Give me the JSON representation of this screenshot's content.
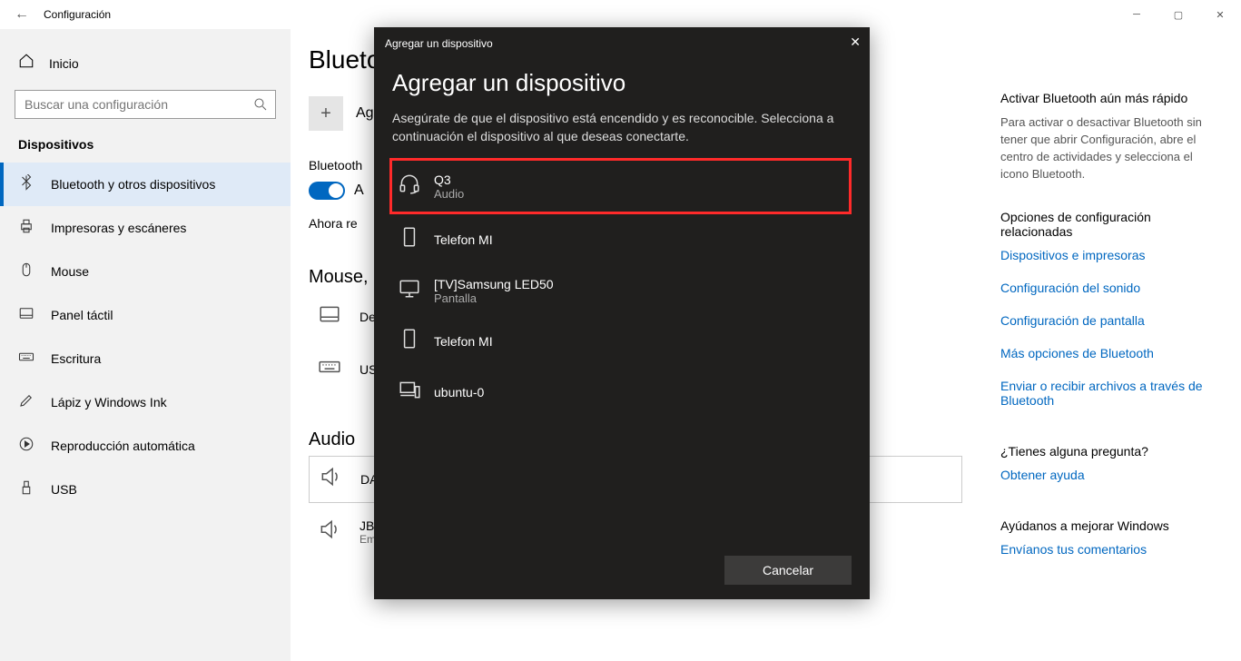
{
  "window": {
    "title": "Configuración"
  },
  "sidebar": {
    "home_label": "Inicio",
    "search_placeholder": "Buscar una configuración",
    "group_label": "Dispositivos",
    "items": [
      {
        "label": "Bluetooth y otros dispositivos",
        "icon": "bluetooth",
        "selected": true
      },
      {
        "label": "Impresoras y escáneres",
        "icon": "printer"
      },
      {
        "label": "Mouse",
        "icon": "mouse"
      },
      {
        "label": "Panel táctil",
        "icon": "touchpad"
      },
      {
        "label": "Escritura",
        "icon": "keyboard"
      },
      {
        "label": "Lápiz y Windows Ink",
        "icon": "pen"
      },
      {
        "label": "Reproducción automática",
        "icon": "autoplay"
      },
      {
        "label": "USB",
        "icon": "usb"
      }
    ]
  },
  "main": {
    "page_title_visible": "Blueto",
    "add_label_visible": "Ag",
    "bluetooth_label_visible": "Bluetooth",
    "toggle_label_visible": "A",
    "discoverable_visible": "Ahora re",
    "section_keyboard": "Mouse,",
    "devices_kb": [
      {
        "name_visible": "De",
        "icon": "touchpad"
      },
      {
        "name_visible": "US",
        "icon": "keyboard"
      }
    ],
    "section_audio": "Audio",
    "devices_audio": [
      {
        "name_visible": "DA",
        "icon": "speaker",
        "selected": true
      },
      {
        "name": "JBL Xtreme",
        "status": "Emparejado",
        "icon": "speaker"
      }
    ]
  },
  "rail": {
    "tip_title": "Activar Bluetooth aún más rápido",
    "tip_body": "Para activar o desactivar Bluetooth sin tener que abrir Configuración, abre el centro de actividades y selecciona el icono Bluetooth.",
    "related_title": "Opciones de configuración relacionadas",
    "links": [
      "Dispositivos e impresoras",
      "Configuración del sonido",
      "Configuración de pantalla",
      "Más opciones de Bluetooth",
      "Enviar o recibir archivos a través de Bluetooth"
    ],
    "question_title": "¿Tienes alguna pregunta?",
    "help_link": "Obtener ayuda",
    "improve_title": "Ayúdanos a mejorar Windows",
    "feedback_link": "Envíanos tus comentarios"
  },
  "modal": {
    "titlebar": "Agregar un dispositivo",
    "heading": "Agregar un dispositivo",
    "subtitle": "Asegúrate de que el dispositivo está encendido y es reconocible. Selecciona a continuación el dispositivo al que deseas conectarte.",
    "devices": [
      {
        "name": "Q3",
        "sub": "Audio",
        "icon": "headset",
        "highlight": true
      },
      {
        "name": "Telefon MI",
        "icon": "phone"
      },
      {
        "name": "[TV]Samsung LED50",
        "sub": "Pantalla",
        "icon": "monitor"
      },
      {
        "name": "Telefon MI",
        "icon": "phone"
      },
      {
        "name": "ubuntu-0",
        "icon": "computer"
      }
    ],
    "cancel": "Cancelar"
  }
}
